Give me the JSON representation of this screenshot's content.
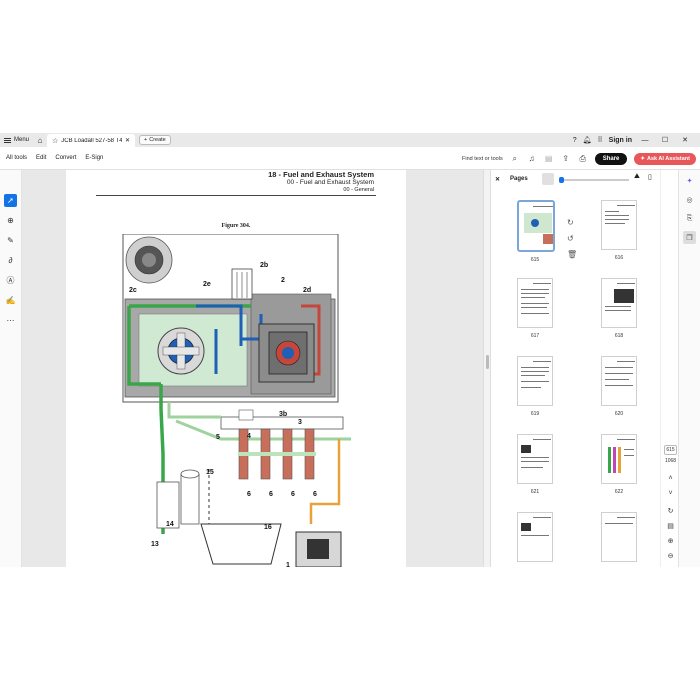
{
  "titlebar": {
    "menu_label": "Menu",
    "tab_title": "JCB Loadall 527-58 T4F ...",
    "create_label": "Create",
    "signin_label": "Sign in"
  },
  "toolbar": {
    "menus": [
      "All tools",
      "Edit",
      "Convert",
      "E-Sign"
    ],
    "find_label": "Find text or tools",
    "share_label": "Share",
    "ai_label": "Ask AI Assistant"
  },
  "document": {
    "header_title": "18 - Fuel and Exhaust System",
    "header_sub": "00 - Fuel and Exhaust System",
    "header_sub2": "00 - General",
    "figure_label": "Figure 304.",
    "callouts": [
      "2b",
      "2",
      "2c",
      "2e",
      "2d",
      "3b",
      "3",
      "5",
      "4",
      "15",
      "14",
      "13",
      "16",
      "6",
      "6",
      "6",
      "6",
      "1"
    ]
  },
  "pages_panel": {
    "title": "Pages",
    "thumbs": [
      "615",
      "616",
      "617",
      "618",
      "619",
      "620",
      "621",
      "622"
    ]
  },
  "page_indicator": {
    "current": "615",
    "total": "1068"
  },
  "colors": {
    "accent": "#1473e6",
    "ai_button": "#e8585a",
    "fuel_green": "#3aa64a",
    "fuel_blue": "#1f5fb5",
    "fuel_red": "#c5463a",
    "fuel_orange": "#e7a23a"
  }
}
